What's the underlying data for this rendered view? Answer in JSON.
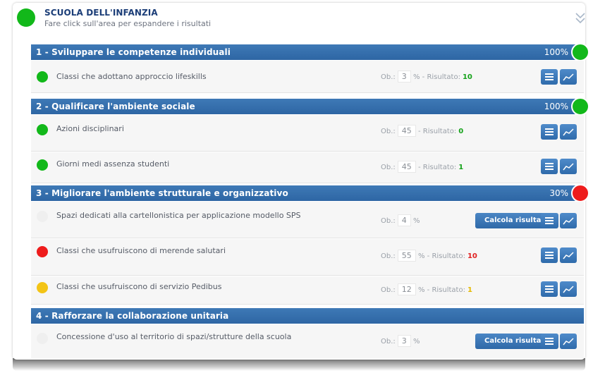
{
  "header": {
    "title": "SCUOLA DELL'INFANZIA",
    "subtitle": "Fare click sull'area per espandere i risultati",
    "status_color": "#12b81a"
  },
  "labels": {
    "ob_label": "Ob.:",
    "result_label": "- Risultato:",
    "calc_button": "Calcola risultato"
  },
  "sections": [
    {
      "title": "1 - Sviluppare le competenze individuali",
      "percent": "100%",
      "status_color": "#12b81a",
      "rows": [
        {
          "label": "Classi che adottano approccio lifeskills",
          "objective": "3",
          "unit": "%",
          "result": "10",
          "result_color": "#15a21a",
          "status_color": "#12b81a"
        }
      ]
    },
    {
      "title": "2 - Qualificare l'ambiente sociale",
      "percent": "100%",
      "status_color": "#12b81a",
      "rows": [
        {
          "label": "Azioni disciplinari",
          "objective": "45",
          "unit": "",
          "result": "0",
          "result_color": "#15a21a",
          "status_color": "#12b81a"
        },
        {
          "label": "Giorni medi assenza studenti",
          "objective": "45",
          "unit": "",
          "result": "1",
          "result_color": "#15a21a",
          "status_color": "#12b81a"
        }
      ]
    },
    {
      "title": "3 - Migliorare l'ambiente strutturale e organizzativo",
      "percent": "30%",
      "status_color": "#ee1c1c",
      "rows": [
        {
          "label": "Spazi dedicati alla cartellonistica per applicazione modello SPS",
          "objective": "4",
          "unit": "%",
          "result": "",
          "status_color": "#efefef"
        },
        {
          "label": "Classi che usufruiscono di merende salutari",
          "objective": "55",
          "unit": "%",
          "result": "10",
          "result_color": "#e02020",
          "status_color": "#ee1c1c"
        },
        {
          "label": "Classi che usufruiscono di servizio Pedibus",
          "objective": "12",
          "unit": "%",
          "result": "1",
          "result_color": "#e4b900",
          "status_color": "#f3c416"
        }
      ]
    },
    {
      "title": "4 - Rafforzare la collaborazione unitaria",
      "percent": "",
      "rows": [
        {
          "label": "Concessione d'uso al territorio di spazi/strutture della scuola",
          "objective": "3",
          "unit": "%",
          "result": "",
          "status_color": "#efefef"
        }
      ]
    }
  ]
}
